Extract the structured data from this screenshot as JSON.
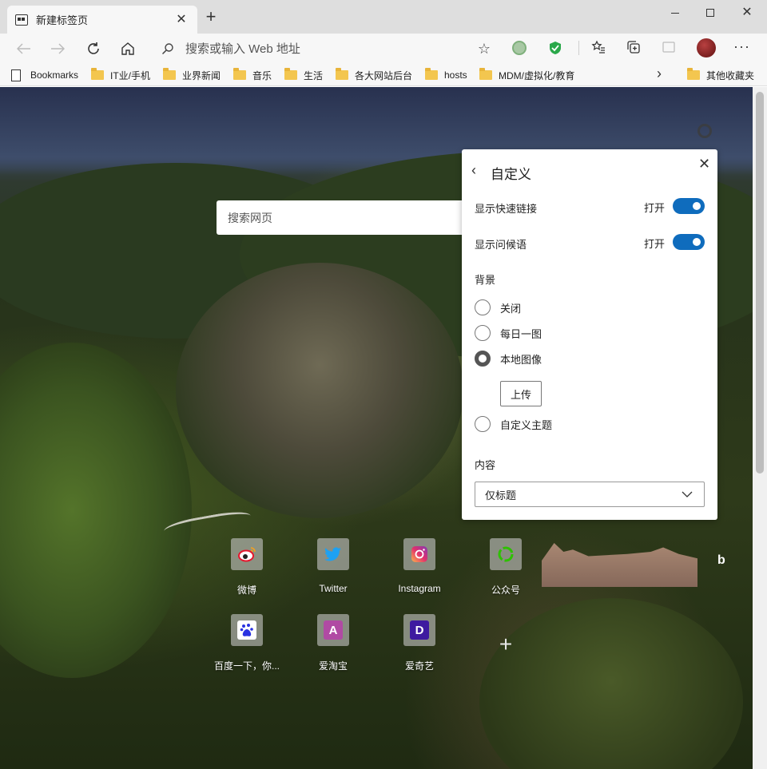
{
  "tab": {
    "title": "新建标签页"
  },
  "address": {
    "placeholder": "搜索或输入 Web 地址"
  },
  "bookmarks": [
    {
      "label": "Bookmarks",
      "type": "page"
    },
    {
      "label": "IT业/手机",
      "type": "folder"
    },
    {
      "label": "业界新闻",
      "type": "folder"
    },
    {
      "label": "音乐",
      "type": "folder"
    },
    {
      "label": "生活",
      "type": "folder"
    },
    {
      "label": "各大网站后台",
      "type": "folder"
    },
    {
      "label": "hosts",
      "type": "folder"
    },
    {
      "label": "MDM/虚拟化/教育",
      "type": "folder"
    },
    {
      "label": "其他收藏夹",
      "type": "folder"
    }
  ],
  "search": {
    "placeholder": "搜索网页"
  },
  "panel": {
    "title": "自定义",
    "show_quick_links": {
      "label": "显示快速链接",
      "state": "打开"
    },
    "show_greeting": {
      "label": "显示问候语",
      "state": "打开"
    },
    "background": {
      "heading": "背景",
      "options": [
        "关闭",
        "每日一图",
        "本地图像",
        "自定义主题"
      ],
      "selected": "本地图像",
      "upload_label": "上传"
    },
    "content": {
      "heading": "内容",
      "selected": "仅标题"
    }
  },
  "quick_links": [
    {
      "label": "微博",
      "icon": "weibo-icon",
      "color": "#e6162d"
    },
    {
      "label": "Twitter",
      "icon": "twitter-icon",
      "color": "#1da1f2"
    },
    {
      "label": "Instagram",
      "icon": "instagram-icon",
      "color": "#d6249f"
    },
    {
      "label": "公众号",
      "icon": "wechat-icon",
      "color": "#2dc100"
    },
    {
      "label": "百度一下，你...",
      "icon": "baidu-icon",
      "color": "#2932e1"
    },
    {
      "label": "爱淘宝",
      "icon": "letter-a-icon",
      "letter": "A",
      "color": "#b04aa3"
    },
    {
      "label": "爱奇艺",
      "icon": "letter-d-icon",
      "letter": "D",
      "color": "#3e1aa0"
    }
  ],
  "colors": {
    "accent": "#0f6cbd"
  }
}
